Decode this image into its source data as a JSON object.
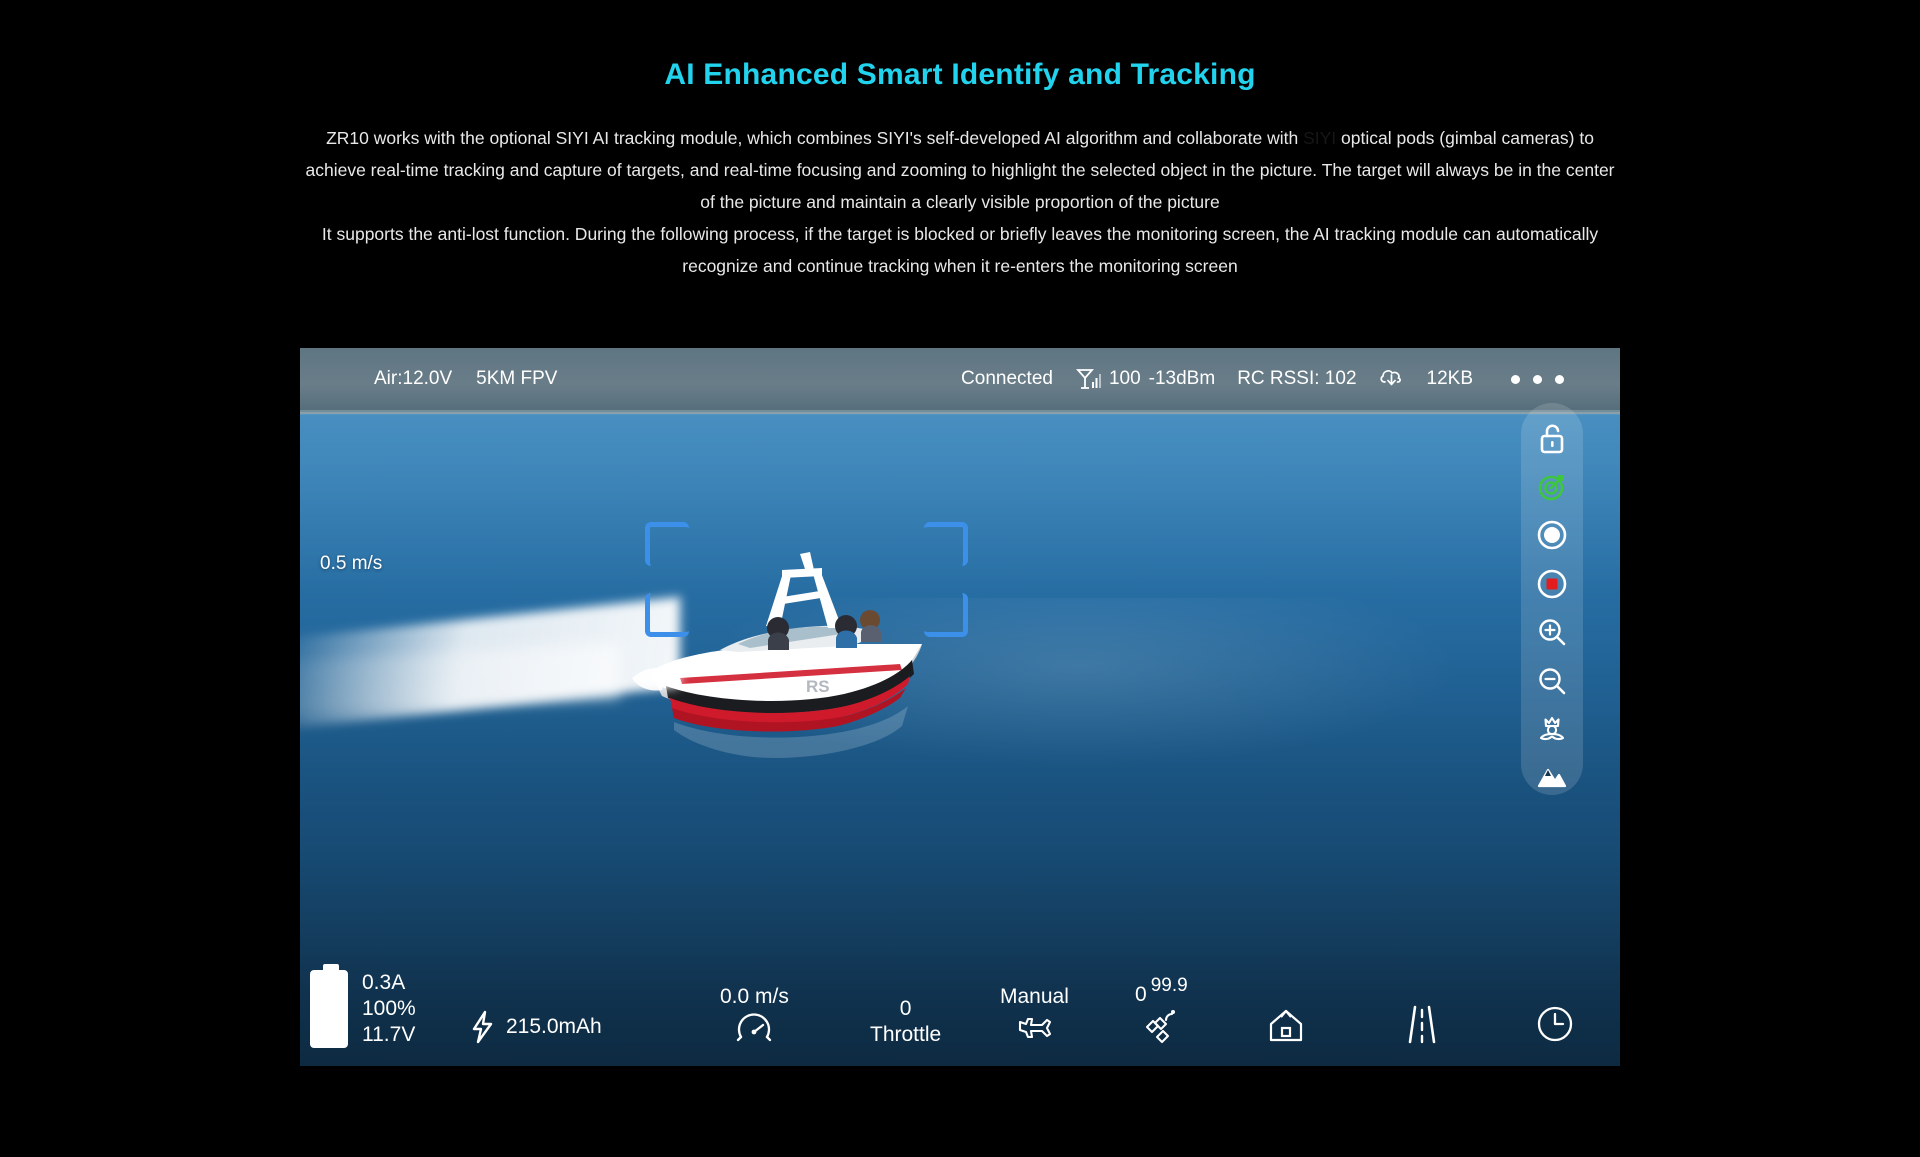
{
  "heading": {
    "title": "AI Enhanced Smart Identify and Tracking"
  },
  "description": {
    "line1_a": "ZR10 works with the optional SIYI AI tracking module, which combines SIYI's self-developed AI algorithm and collaborate with ",
    "line1_ghost": "SIYI",
    "line1_b": " optical pods (gimbal cameras) to achieve real-time tracking and capture of targets, and real-time focusing and zooming to highlight the selected object in the picture. The target will always be in the center of the picture and maintain a clearly visible proportion of the picture",
    "line2": "It supports the anti-lost function. During the following process, if the target is blocked or briefly leaves the monitoring screen, the AI tracking module can automatically recognize and continue tracking when it re-enters the monitoring screen"
  },
  "colors": {
    "title_cyan": "#22d3ee",
    "tracking_blue": "#3d90ea",
    "tracking_active_green": "#3ec63e",
    "record_red": "#e11d1d",
    "page_background": "#000000"
  },
  "video_hud": {
    "top_bar": {
      "air_voltage": "Air:12.0V",
      "link_mode": "5KM FPV",
      "connection_status": "Connected",
      "signal_value": "100",
      "signal_dbm": "-13dBm",
      "rc_rssi": "RC RSSI: 102",
      "data_rate": "12KB",
      "menu_dots": 3
    },
    "speed_tag": "0.5 m/s",
    "tool_rail": [
      {
        "name": "unlock-icon",
        "label": "Unlock",
        "state": "unlocked"
      },
      {
        "name": "ai-tracking-icon",
        "label": "AI Tracking",
        "state": "active"
      },
      {
        "name": "photo-capture-icon",
        "label": "Photo"
      },
      {
        "name": "video-record-icon",
        "label": "Record"
      },
      {
        "name": "zoom-in-icon",
        "label": "Zoom In"
      },
      {
        "name": "zoom-out-icon",
        "label": "Zoom Out"
      },
      {
        "name": "macro-focus-icon",
        "label": "Near Focus"
      },
      {
        "name": "landscape-focus-icon",
        "label": "Far Focus"
      }
    ],
    "bottom_bar": {
      "battery": {
        "current": "0.3A",
        "percent": "100%",
        "voltage": "11.7V"
      },
      "consumed": "215.0mAh",
      "ground_speed": "0.0 m/s",
      "throttle_value": "0",
      "throttle_label": "Throttle",
      "flight_mode": "Manual",
      "gps_sats": "0",
      "gps_hdop": "99.9",
      "home_distance": "",
      "track_distance": "",
      "flight_time": "",
      "temperature": "",
      "altitude": ""
    }
  }
}
